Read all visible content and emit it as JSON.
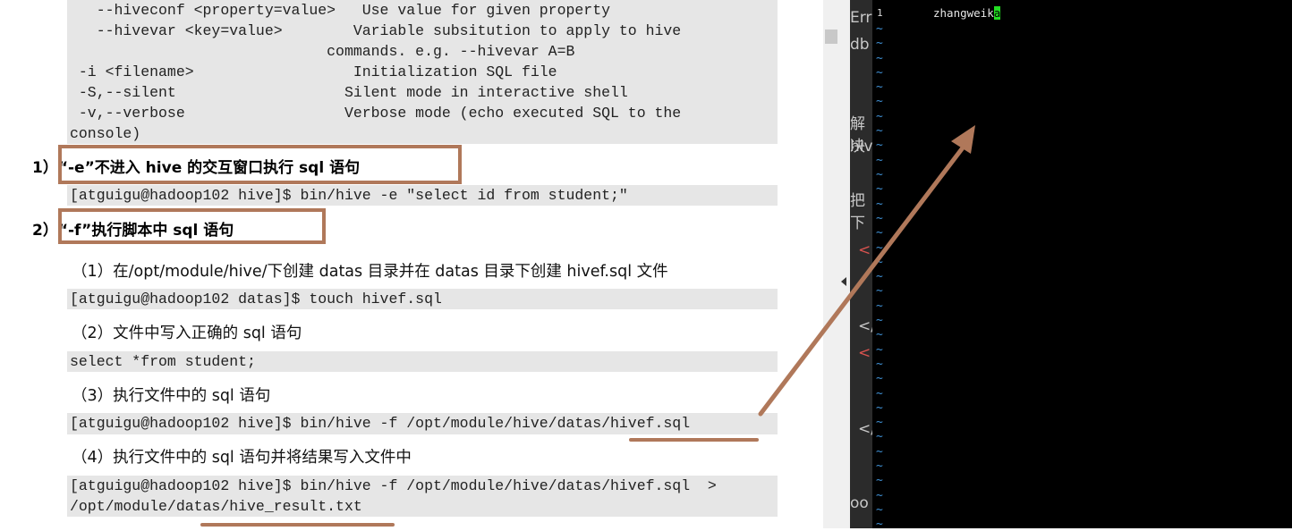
{
  "doc": {
    "options_block": [
      "   --hiveconf <property=value>   Use value for given property",
      "   --hivevar <key=value>        Variable subsitution to apply to hive",
      "                             commands. e.g. --hivevar A=B",
      " -i <filename>                  Initialization SQL file",
      " -S,--silent                   Silent mode in interactive shell",
      " -v,--verbose                  Verbose mode (echo executed SQL to the",
      "console)"
    ],
    "h1": "1）“-e”不进入 hive 的交互窗口执行 sql 语句",
    "cmd1": "[atguigu@hadoop102 hive]$ bin/hive -e \"select id from student;\"",
    "h2": "2）“-f”执行脚本中 sql 语句",
    "step1": "（1）在/opt/module/hive/下创建 datas 目录并在 datas 目录下创建 hivef.sql 文件",
    "cmd2": "[atguigu@hadoop102 datas]$ touch hivef.sql",
    "step2": "（2）文件中写入正确的 sql 语句",
    "cmd3": "select *from student;",
    "step3": "（3）执行文件中的 sql 语句",
    "cmd4": "[atguigu@hadoop102 hive]$ bin/hive -f /opt/module/hive/datas/hivef.sql",
    "step4": "（4）执行文件中的 sql 语句并将结果写入文件中",
    "cmd5_line1": "[atguigu@hadoop102 hive]$ bin/hive -f /opt/module/hive/datas/hivef.sql  >",
    "cmd5_line2": "/opt/module/datas/hive_result.txt"
  },
  "editor_strip": {
    "fragments": [
      "Erro",
      "db",
      "解决",
      "hive",
      "把下",
      "<",
      "</",
      "<",
      "</",
      "oo"
    ]
  },
  "terminal": {
    "line_number": "1",
    "text_before_cursor": "zhangweik",
    "cursor_char": "a",
    "tilde": "~"
  },
  "colors": {
    "annotation": "#b0785a",
    "cursor": "#22dd22",
    "tilde": "#3f8fd2"
  }
}
